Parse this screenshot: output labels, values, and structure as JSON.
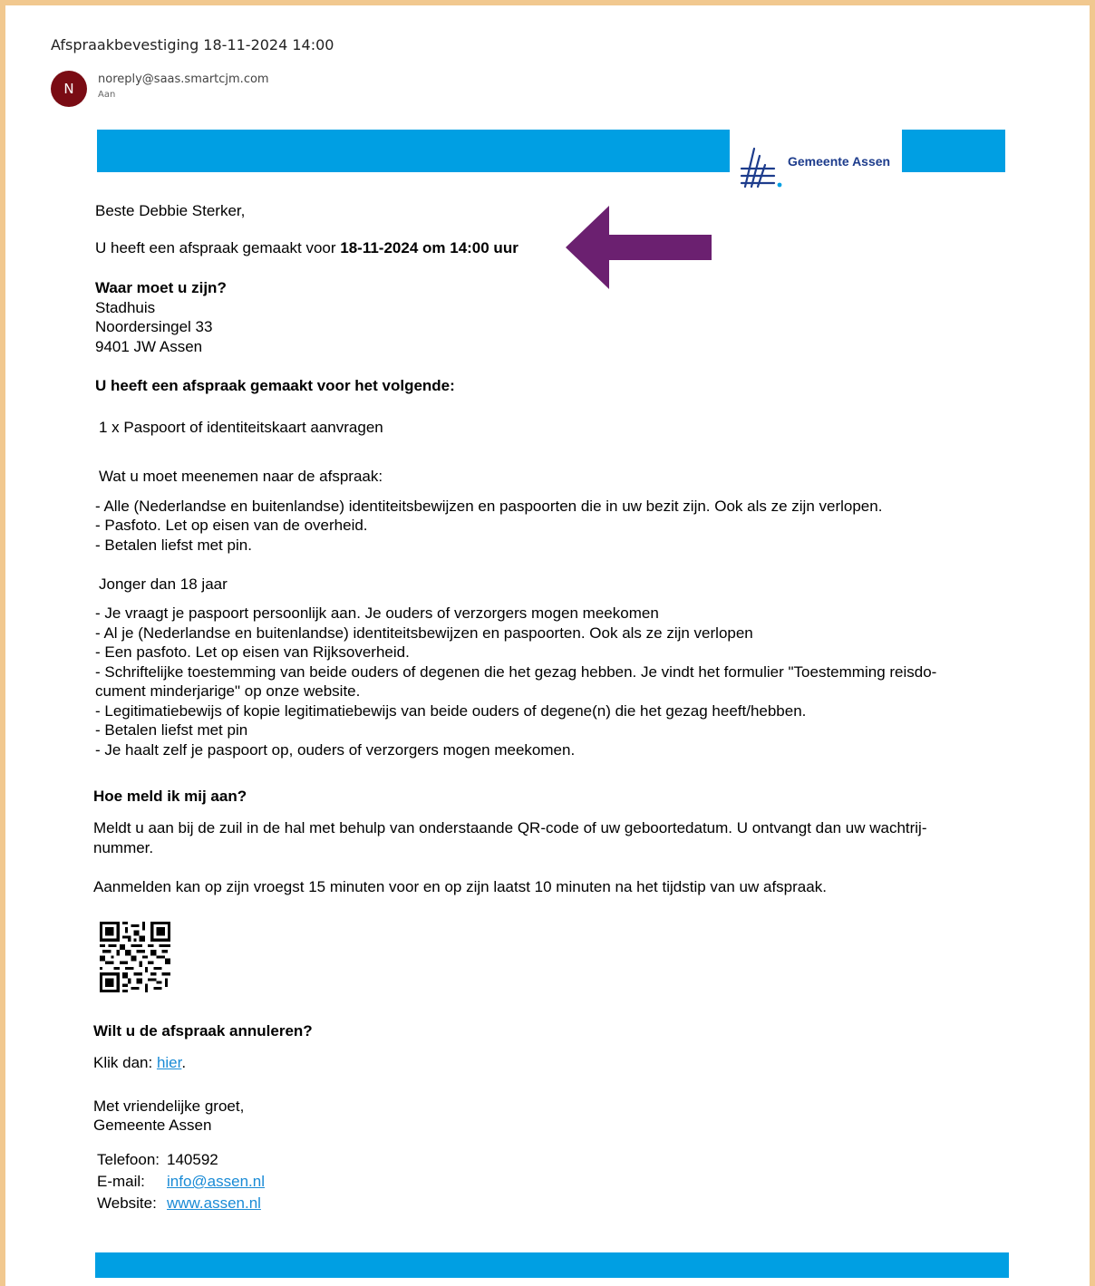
{
  "email": {
    "subject": "Afspraakbevestiging 18-11-2024 14:00",
    "avatar_initial": "N",
    "sender": "noreply@saas.smartcjm.com",
    "recipient_label": "Aan"
  },
  "brand": {
    "logo_text": "Gemeente Assen",
    "bar_color": "#009FE3"
  },
  "body": {
    "greeting": "Beste Debbie Sterker,",
    "appointment_prefix": "U heeft een afspraak gemaakt voor ",
    "appointment_datetime": "18-11-2024 om 14:00 uur",
    "location_heading": "Waar moet u zijn?",
    "location_lines": [
      "Stadhuis",
      "Noordersingel 33",
      "9401 JW Assen"
    ],
    "service_heading": "U heeft een afspraak gemaakt voor het volgende:",
    "service_item": "1 x Paspoort of identiteitskaart aanvragen",
    "bring_heading": "Wat u moet meenemen naar de afspraak:",
    "bring_items": [
      "- Alle (Nederlandse en buitenlandse) identiteitsbewijzen en paspoorten die in uw bezit zijn. Ook als ze zijn verlopen.",
      "- Pasfoto. Let op eisen van de overheid.",
      "- Betalen liefst met pin."
    ],
    "minor_heading": "Jonger dan 18 jaar",
    "minor_items": [
      "- Je vraagt je paspoort persoonlijk aan. Je ouders of verzorgers mogen meekomen",
      "- Al je (Nederlandse en buitenlandse) identiteitsbewijzen en paspoorten. Ook als ze zijn verlopen",
      "- Een pasfoto. Let op eisen van Rijksoverheid.",
      "- Schriftelijke toestemming van beide ouders of degenen die het gezag hebben. Je vindt het formulier \"Toestemming reisdo-",
      "cument minderjarige\" op onze website.",
      "- Legitimatiebewijs of kopie legitimatiebewijs van beide ouders of degene(n) die het gezag heeft/hebben.",
      "- Betalen liefst met pin",
      "- Je haalt zelf je paspoort op, ouders of verzorgers mogen meekomen."
    ],
    "checkin_heading": "Hoe meld ik mij aan?",
    "checkin_lines": [
      "Meldt u aan bij de zuil in de hal met behulp van onderstaande QR-code of uw geboortedatum. U ontvangt dan uw wachtrij-",
      "nummer."
    ],
    "checkin_window": "Aanmelden kan op zijn vroegst 15 minuten voor en op zijn laatst 10 minuten na het tijdstip van uw afspraak.",
    "cancel_heading": "Wilt u de afspraak annuleren?",
    "cancel_prefix": "Klik dan: ",
    "cancel_link": "hier",
    "cancel_suffix": ".",
    "closing": "Met vriendelijke groet,",
    "signature": "Gemeente Assen",
    "contact": {
      "phone_label": "Telefoon:",
      "phone": "140592",
      "email_label": "E-mail:",
      "email": "info@assen.nl",
      "website_label": "Website:",
      "website": "www.assen.nl"
    }
  },
  "annotation": {
    "arrow_color": "#6B2070"
  }
}
